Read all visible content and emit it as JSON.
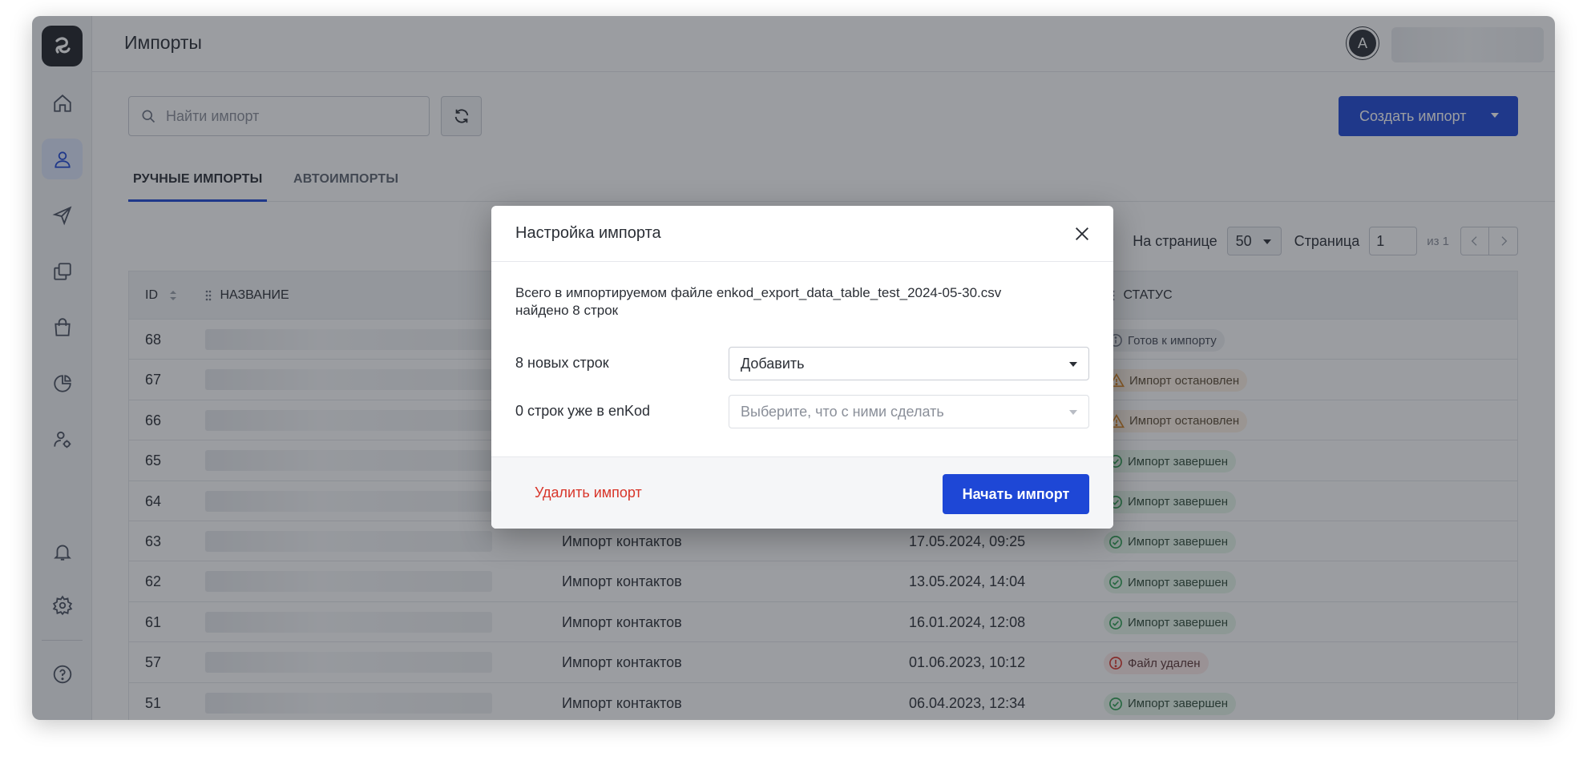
{
  "header": {
    "title": "Импорты",
    "avatar_letter": "A"
  },
  "toolbar": {
    "search_placeholder": "Найти импорт",
    "create_label": "Создать импорт"
  },
  "tabs": [
    {
      "label": "РУЧНЫЕ ИМПОРТЫ",
      "active": true
    },
    {
      "label": "АВТОИМПОРТЫ",
      "active": false
    }
  ],
  "pagination": {
    "per_page_label": "На странице",
    "per_page_value": "50",
    "page_label": "Страница",
    "page_value": "1",
    "page_of": "из 1"
  },
  "table": {
    "columns": {
      "id": "ID",
      "name": "НАЗВАНИЕ",
      "status": "СТАТУС"
    },
    "rows": [
      {
        "id": "68",
        "type": "",
        "date": "",
        "status": "Готов к импорту",
        "status_kind": "ready"
      },
      {
        "id": "67",
        "type": "",
        "date": "",
        "status": "Импорт остановлен",
        "status_kind": "stopped"
      },
      {
        "id": "66",
        "type": "",
        "date": "",
        "status": "Импорт остановлен",
        "status_kind": "stopped"
      },
      {
        "id": "65",
        "type": "",
        "date": "",
        "status": "Импорт завершен",
        "status_kind": "done"
      },
      {
        "id": "64",
        "type": "",
        "date": "",
        "status": "Импорт завершен",
        "status_kind": "done"
      },
      {
        "id": "63",
        "type": "Импорт контактов",
        "date": "17.05.2024, 09:25",
        "status": "Импорт завершен",
        "status_kind": "done"
      },
      {
        "id": "62",
        "type": "Импорт контактов",
        "date": "13.05.2024, 14:04",
        "status": "Импорт завершен",
        "status_kind": "done"
      },
      {
        "id": "61",
        "type": "Импорт контактов",
        "date": "16.01.2024, 12:08",
        "status": "Импорт завершен",
        "status_kind": "done"
      },
      {
        "id": "57",
        "type": "Импорт контактов",
        "date": "01.06.2023, 10:12",
        "status": "Файл удален",
        "status_kind": "deleted"
      },
      {
        "id": "51",
        "type": "Импорт контактов",
        "date": "06.04.2023, 12:34",
        "status": "Импорт завершен",
        "status_kind": "done"
      }
    ]
  },
  "modal": {
    "title": "Настройка импорта",
    "info_prefix": "Всего в импортируемом файле ",
    "file_name": "enkod_export_data_table_test_2024-05-30.csv",
    "info_found_prefix": "найдено ",
    "info_found_count": "8 строк",
    "new_rows_count": "8",
    "new_rows_label": " новых строк",
    "new_rows_action": "Добавить",
    "existing_rows_count": "0",
    "existing_rows_label": " строк уже в enKod",
    "existing_rows_placeholder": "Выберите, что с ними сделать",
    "delete_label": "Удалить импорт",
    "start_label": "Начать импорт"
  },
  "colors": {
    "accent": "#1e47d6",
    "danger": "#d8352a",
    "success": "#2e9e52",
    "warning": "#d9831f",
    "overlay": "rgba(34,38,46,0.45)"
  },
  "icons": [
    "app-logo-icon",
    "home-icon",
    "contacts-icon",
    "send-icon",
    "templates-icon",
    "shop-icon",
    "analytics-icon",
    "users-settings-icon",
    "bell-icon",
    "gear-icon",
    "help-icon",
    "search-icon",
    "refresh-icon",
    "close-icon",
    "chevron-left-icon",
    "chevron-right-icon",
    "sort-icon",
    "drag-handle-icon"
  ]
}
